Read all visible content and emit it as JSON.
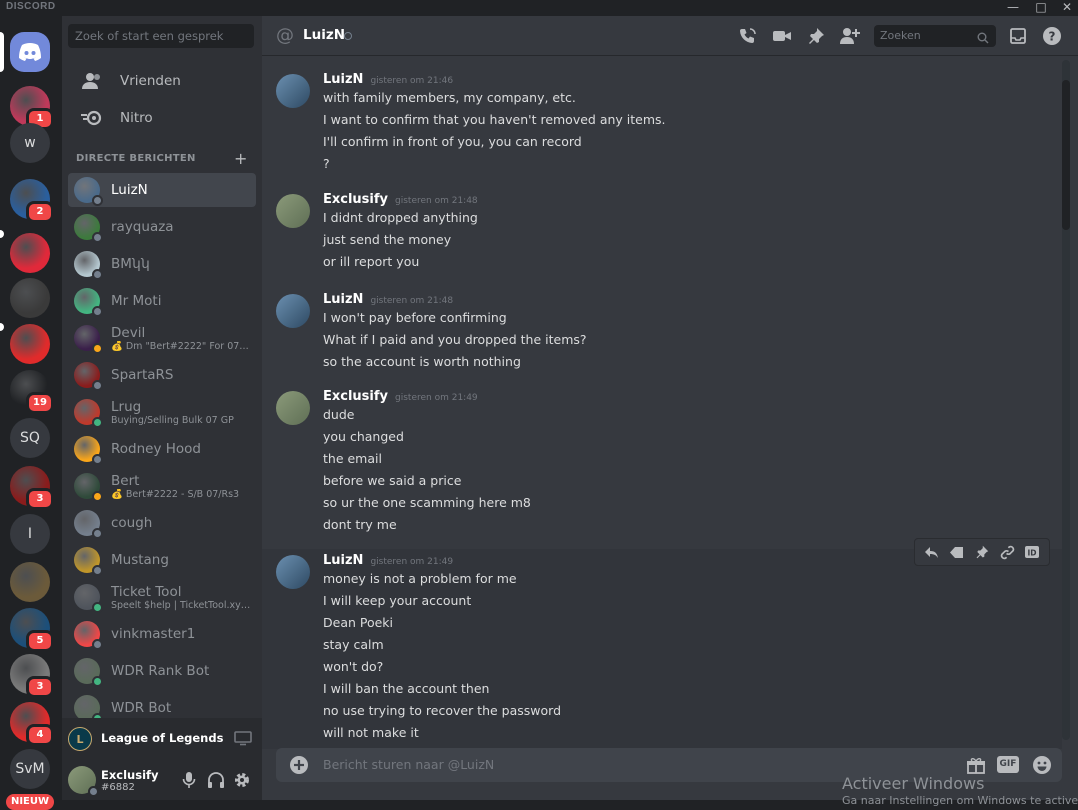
{
  "app": {
    "brand": "DISCORD",
    "window_controls": [
      "—",
      "□",
      "✕"
    ]
  },
  "guild_rail": {
    "servers": [
      {
        "label": "",
        "badge": "",
        "color": "#7289da",
        "kind": "home"
      },
      {
        "label": "",
        "badge": "1",
        "color": "#c0395a",
        "kind": "avatar"
      },
      {
        "label": "w",
        "badge": "",
        "color": "#36393f",
        "kind": "text"
      },
      {
        "label": "",
        "badge": "2",
        "color": "#2a5f9e",
        "kind": "avatar"
      },
      {
        "label": "",
        "badge": "",
        "color": "#e0293a",
        "kind": "avatar"
      },
      {
        "label": "",
        "badge": "",
        "color": "#3a3a3a",
        "kind": "avatar"
      },
      {
        "label": "",
        "badge": "",
        "color": "#e02b2b",
        "kind": "avatar"
      },
      {
        "label": "",
        "badge": "19",
        "color": "#202225",
        "kind": "avatar"
      },
      {
        "label": "SQ",
        "badge": "",
        "color": "#36393f",
        "kind": "text"
      },
      {
        "label": "",
        "badge": "3",
        "color": "#8a1c1c",
        "kind": "avatar"
      },
      {
        "label": "I",
        "badge": "",
        "color": "#36393f",
        "kind": "text"
      },
      {
        "label": "",
        "badge": "",
        "color": "#6b5a3a",
        "kind": "avatar"
      },
      {
        "label": "",
        "badge": "5",
        "color": "#1c4f7a",
        "kind": "avatar"
      },
      {
        "label": "",
        "badge": "3",
        "color": "#7a7a7a",
        "kind": "avatar"
      },
      {
        "label": "",
        "badge": "4",
        "color": "#e02b2b",
        "kind": "avatar"
      },
      {
        "label": "SvM",
        "badge": "",
        "color": "#36393f",
        "kind": "text"
      }
    ],
    "new_label": "NIEUW"
  },
  "dm_sidebar": {
    "search_placeholder": "Zoek of start een gesprek",
    "nav": [
      {
        "label": "Vrienden",
        "icon": "friends-icon"
      },
      {
        "label": "Nitro",
        "icon": "nitro-icon"
      }
    ],
    "section_title": "DIRECTE BERICHTEN",
    "dms": [
      {
        "name": "LuizN",
        "sub": "",
        "status": "offline",
        "color": "#4a6a8a",
        "active": true
      },
      {
        "name": "rayquaza",
        "sub": "",
        "status": "offline",
        "color": "#3c7a3c"
      },
      {
        "name": "BMʮʮ",
        "sub": "",
        "status": "offline",
        "color": "#b5c8d0"
      },
      {
        "name": "Mr Moti",
        "sub": "",
        "status": "offline",
        "color": "#43b581"
      },
      {
        "name": "Devil",
        "sub": "💰 Dm \"Bert#2222\" For 07 ...",
        "status": "idle",
        "color": "#3a1f4a"
      },
      {
        "name": "SpartaRS",
        "sub": "",
        "status": "offline",
        "color": "#8a1c1c"
      },
      {
        "name": "Lrug",
        "sub": "Buying/Selling Bulk 07 GP",
        "status": "online",
        "color": "#c0392b"
      },
      {
        "name": "Rodney Hood",
        "sub": "",
        "status": "offline",
        "color": "#faa61a"
      },
      {
        "name": "Bert",
        "sub": "💰 Bert#2222 - S/B 07/Rs3",
        "status": "idle",
        "color": "#2f4a3a"
      },
      {
        "name": "cough",
        "sub": "",
        "status": "offline",
        "color": "#747f8d"
      },
      {
        "name": "Mustang",
        "sub": "",
        "status": "offline",
        "color": "#c0962a"
      },
      {
        "name": "Ticket Tool",
        "sub": "Speelt $help | TicketTool.xyz...",
        "status": "online",
        "color": "#4f545c"
      },
      {
        "name": "vinkmaster1",
        "sub": "",
        "status": "offline",
        "color": "#f04747"
      },
      {
        "name": "WDR Rank Bot",
        "sub": "",
        "status": "online",
        "color": "#5a6a5a"
      },
      {
        "name": "WDR Bot",
        "sub": "",
        "status": "online",
        "color": "#5a6a5a"
      }
    ],
    "activity": {
      "game": "League of Legends"
    },
    "user": {
      "name": "Exclusify",
      "tag": "#6882"
    }
  },
  "chat": {
    "header": {
      "name": "LuizN",
      "search_placeholder": "Zoeken"
    },
    "messages": [
      {
        "author": "LuizN",
        "time": "gisteren om 21:46",
        "lines": [
          "with family members, my company, etc.",
          "I want to confirm that you haven't removed any items.",
          "I'll confirm in front of you, you can record",
          "?"
        ]
      },
      {
        "author": "Exclusify",
        "time": "gisteren om 21:48",
        "lines": [
          "I didnt dropped anything",
          "just send the money",
          "or ill report you"
        ]
      },
      {
        "author": "LuizN",
        "time": "gisteren om 21:48",
        "lines": [
          "I won't pay before confirming",
          "What if I paid and you dropped the items?",
          "so the account is worth nothing"
        ]
      },
      {
        "author": "Exclusify",
        "time": "gisteren om 21:49",
        "lines": [
          "dude",
          "you changed",
          "the email",
          "before we said a price",
          "so ur the one scamming here m8",
          "dont try me"
        ]
      },
      {
        "author": "LuizN",
        "time": "gisteren om 21:49",
        "lines": [
          "money is not a problem for me",
          "I will keep your account",
          "Dean Poeki",
          "stay calm",
          "won't do?",
          "I will ban the account then",
          "no use trying to recover the password",
          "will not make it"
        ]
      }
    ],
    "composer_placeholder": "Bericht sturen naar @LuizN",
    "gif_label": "GIF"
  },
  "overlay": {
    "activate_windows": "Activeer Windows",
    "activate_windows_sub": "Ga naar Instellingen om Windows te activeren."
  },
  "colors": {
    "blurple": "#7289da",
    "online": "#43b581",
    "idle": "#faa61a",
    "mention_red": "#f04747"
  }
}
